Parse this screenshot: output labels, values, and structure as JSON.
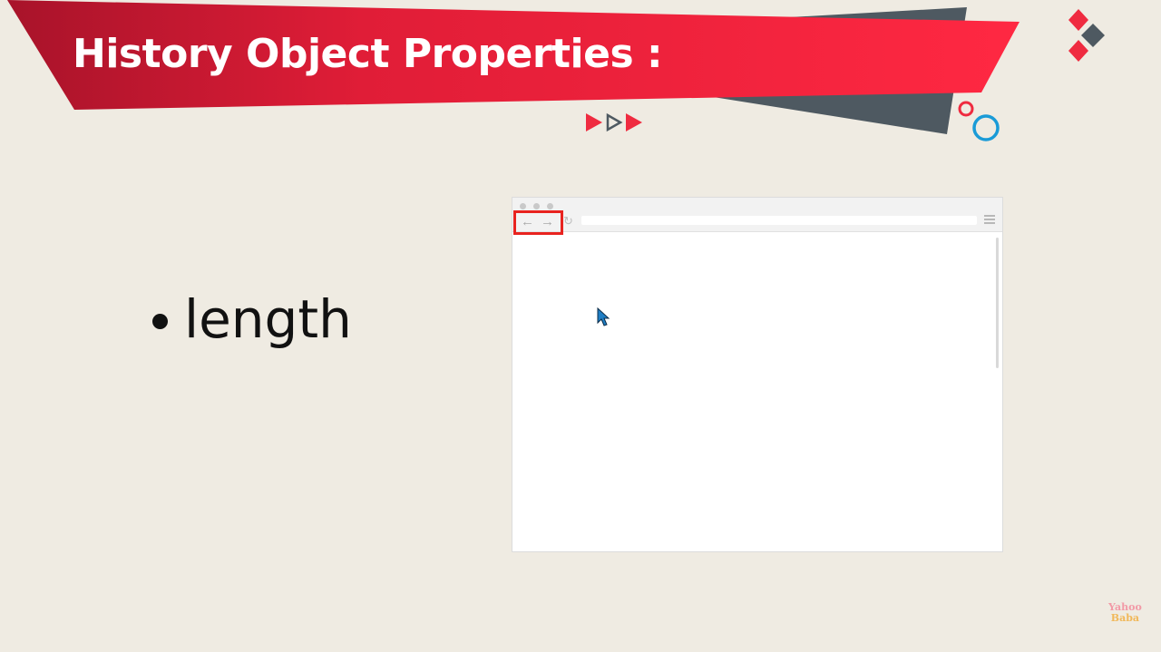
{
  "slide": {
    "title": "History Object Properties :",
    "bullets": [
      "length"
    ]
  },
  "browser": {
    "back_icon": "←",
    "forward_icon": "→",
    "reload_icon": "↻",
    "address_value": ""
  },
  "watermark": {
    "line1": "Yahoo",
    "line2": "Baba"
  },
  "colors": {
    "background": "#efebe2",
    "banner_red": "#ff2040",
    "banner_dark_red": "#a8132a",
    "banner_gray": "#4e5961",
    "highlight_red": "#e8231f",
    "circle_blue": "#1a9bd7"
  },
  "icons": [
    "diamond-shapes",
    "play-arrows",
    "circle-shapes",
    "arrow-cursor",
    "menu-icon"
  ]
}
